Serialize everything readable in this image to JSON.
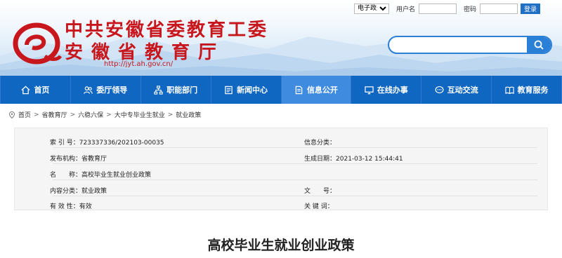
{
  "header": {
    "title_line1": "中共安徽省委教育工委",
    "title_line2": "安徽省教育厅",
    "url": "http://jyt.ah.gov.cn/",
    "brand_color": "#c8161d"
  },
  "login": {
    "select_value": "电子政务",
    "username_label": "用户名",
    "password_label": "密码",
    "login_label": "登录"
  },
  "search": {
    "placeholder": ""
  },
  "nav": {
    "items": [
      {
        "label": "首页",
        "icon": "home-icon"
      },
      {
        "label": "委厅领导",
        "icon": "people-icon"
      },
      {
        "label": "职能部门",
        "icon": "org-chart-icon"
      },
      {
        "label": "新闻中心",
        "icon": "news-icon"
      },
      {
        "label": "信息公开",
        "icon": "document-icon",
        "active": true
      },
      {
        "label": "在线办事",
        "icon": "monitor-icon"
      },
      {
        "label": "互动交流",
        "icon": "chat-icon"
      },
      {
        "label": "教育服务",
        "icon": "book-icon"
      }
    ],
    "bg_color": "#0f67c2",
    "active_color": "#3f8be0"
  },
  "breadcrumb": {
    "items": [
      "首页",
      "省教育厅",
      "六稳六保",
      "大中专毕业生就业",
      "就业政策"
    ]
  },
  "info": {
    "index_label": "索 引 号：",
    "index_value": "723337336/202103-00035",
    "info_category_label": "信息分类：",
    "info_category_value": "",
    "publisher_label": "发布机构：",
    "publisher_value": "省教育厅",
    "date_label": "生成日期：",
    "date_value": "2021-03-12 15:44:41",
    "name_label": "名　　称：",
    "name_value": "高校毕业生就业创业政策",
    "content_category_label": "内容分类：",
    "content_category_value": "就业政策",
    "doc_no_label": "文　　号：",
    "doc_no_value": "",
    "validity_label": "有 效 性：",
    "validity_value": "有效",
    "keywords_label": "关 键 词：",
    "keywords_value": ""
  },
  "document": {
    "title": "高校毕业生就业创业政策"
  }
}
